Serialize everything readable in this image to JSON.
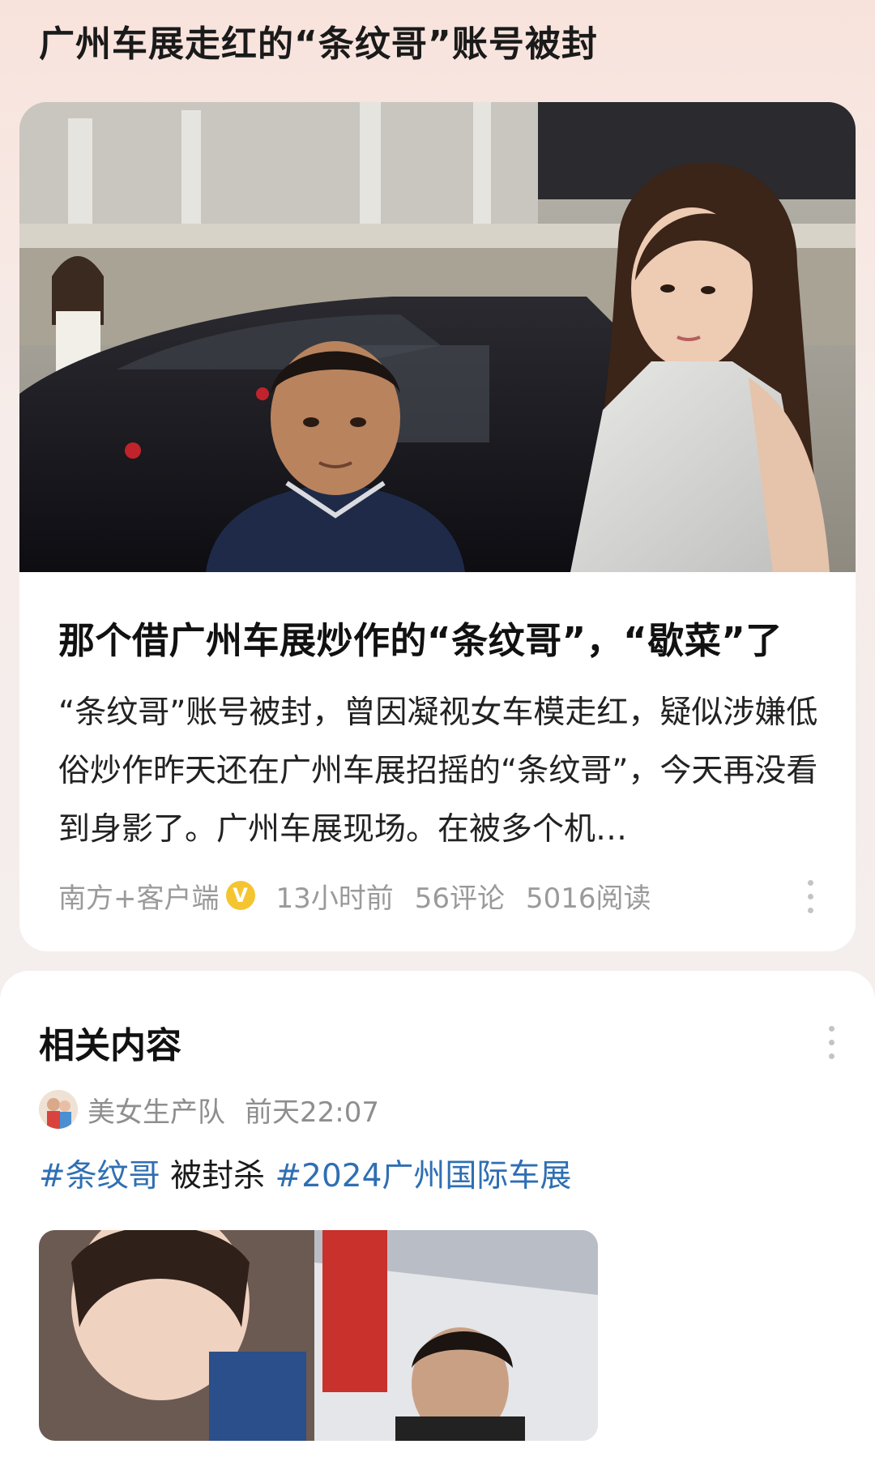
{
  "page": {
    "title": "广州车展走红的“条纹哥”账号被封"
  },
  "news_card": {
    "headline": "那个借广州车展炒作的“条纹哥”，“歇菜”了",
    "summary": "“条纹哥”账号被封，曾因凝视女车模走红，疑似涉嫌低俗炒作昨天还在广州车展招摇的“条纹哥”，今天再没看到身影了。广州车展现场。在被多个机…",
    "source": "南方+客户端",
    "verified_badge": "V",
    "time": "13小时前",
    "comments": "56评论",
    "reads": "5016阅读",
    "icons": {
      "verified": "verified-badge-icon",
      "more": "more-vertical-icon"
    }
  },
  "related": {
    "title": "相关内容",
    "author": "美女生产队",
    "time": "前天22:07",
    "tag1": "#条纹哥",
    "text": " 被封杀 ",
    "tag2": "#2024广州国际车展"
  },
  "colors": {
    "tag": "#2f6fb3",
    "badge": "#f4c531",
    "meta": "#9a9a9a"
  }
}
